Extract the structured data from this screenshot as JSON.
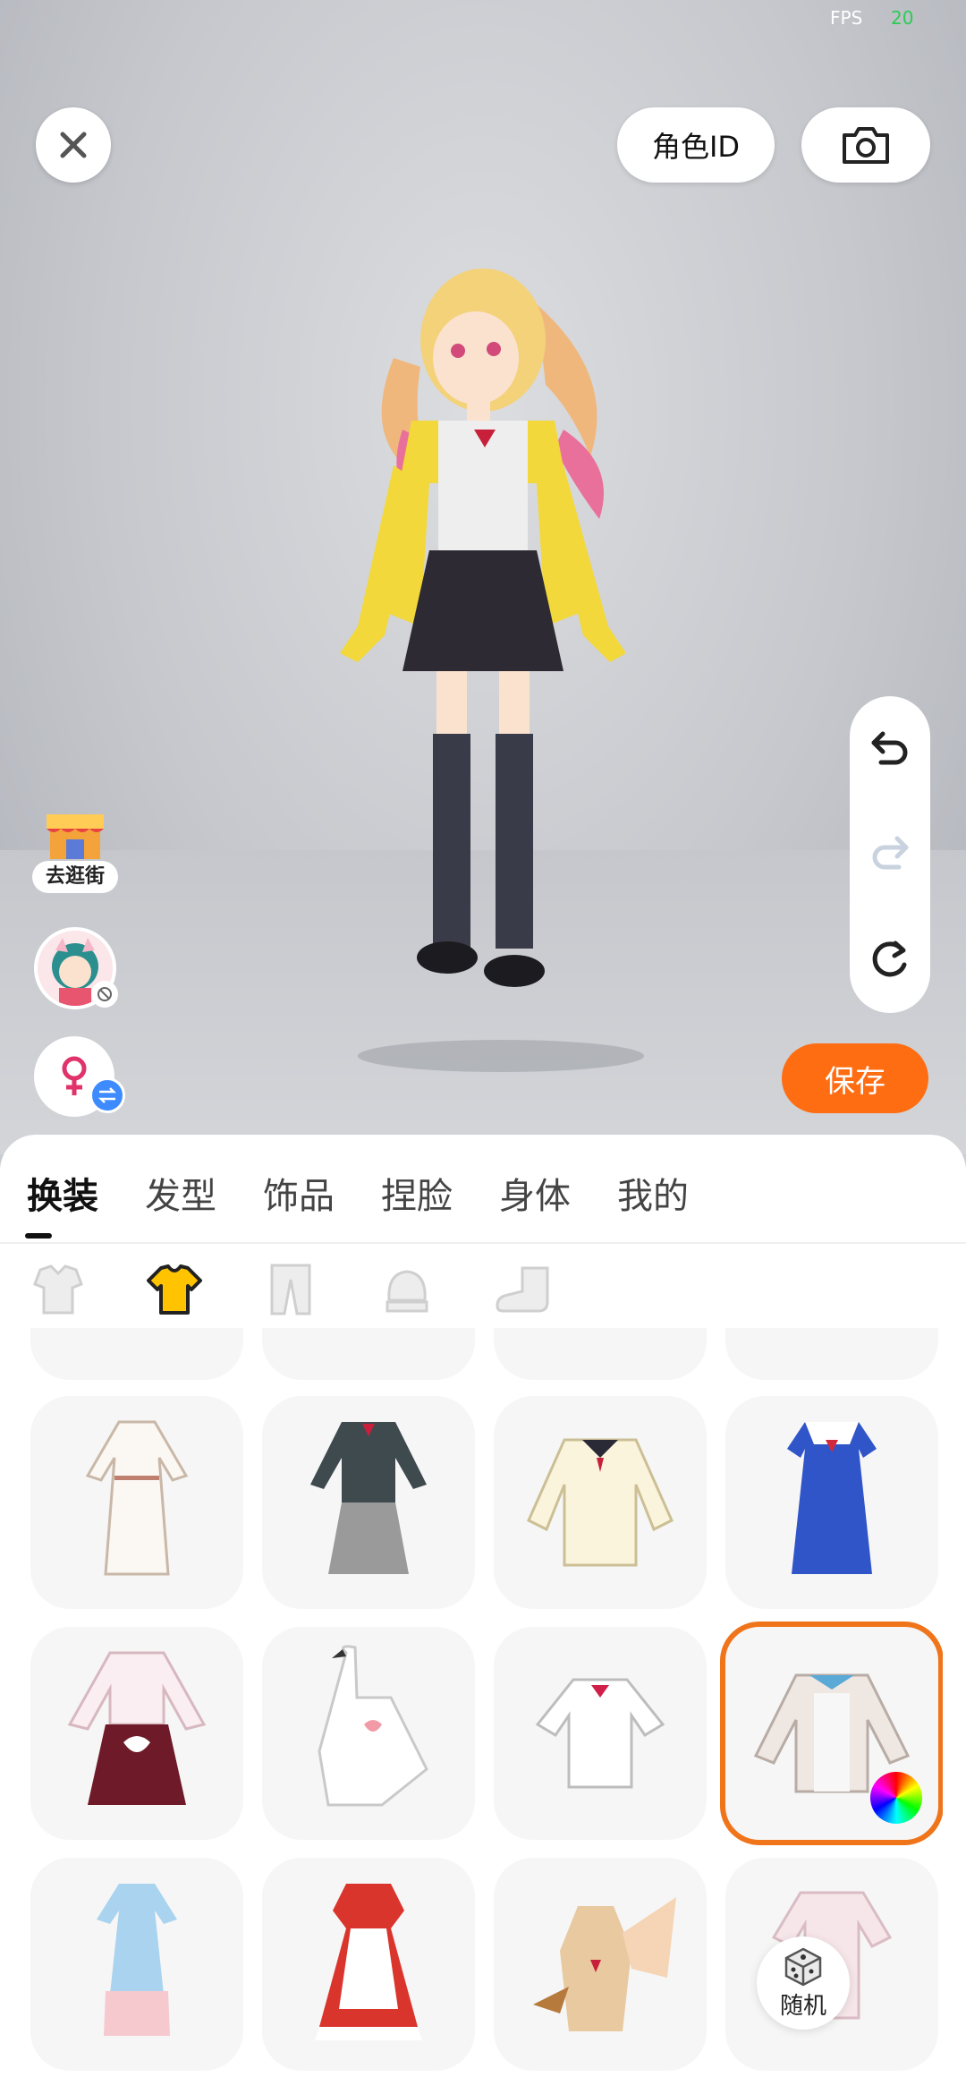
{
  "status": {
    "fps_label": "FPS",
    "fps_value": "20"
  },
  "topbar": {
    "role_id_label": "角色ID"
  },
  "side": {
    "shop_label": "去逛街"
  },
  "actions": {
    "save_label": "保存"
  },
  "tabs": [
    {
      "label": "换装",
      "active": true
    },
    {
      "label": "发型",
      "active": false
    },
    {
      "label": "饰品",
      "active": false
    },
    {
      "label": "捏脸",
      "active": false
    },
    {
      "label": "身体",
      "active": false
    },
    {
      "label": "我的",
      "active": false
    }
  ],
  "subcategories": [
    {
      "icon": "suit-icon",
      "active": false
    },
    {
      "icon": "shirt-icon",
      "active": true
    },
    {
      "icon": "pants-icon",
      "active": false
    },
    {
      "icon": "glove-icon",
      "active": false
    },
    {
      "icon": "shoe-icon",
      "active": false
    }
  ],
  "random": {
    "label": "随机"
  },
  "colors": {
    "accent": "#ff6d12",
    "selected_border": "#f0741a",
    "swap_badge": "#3d8bff"
  }
}
